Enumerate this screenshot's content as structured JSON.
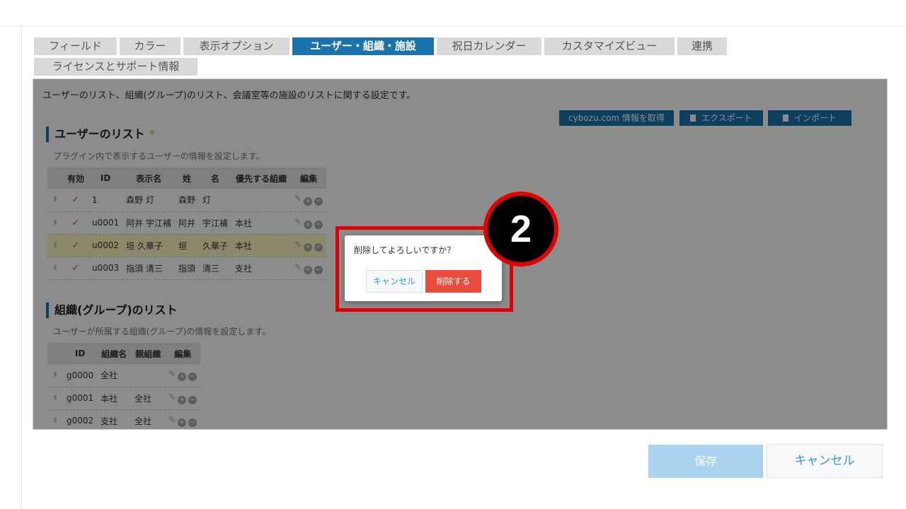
{
  "tabs": [
    {
      "label": "フィールド",
      "active": false
    },
    {
      "label": "カラー",
      "active": false
    },
    {
      "label": "表示オプション",
      "active": false
    },
    {
      "label": "ユーザー・組織・施設",
      "active": true
    },
    {
      "label": "祝日カレンダー",
      "active": false
    },
    {
      "label": "カスタマイズビュー",
      "active": false
    },
    {
      "label": "連携",
      "active": false
    },
    {
      "label": "ライセンスとサポート情報",
      "active": false
    }
  ],
  "panel": {
    "description": "ユーザーのリスト、組織(グループ)のリスト、会議室等の施設のリストに関する設定です。",
    "buttons": {
      "cybozu": "cybozu.com 情報を取得",
      "export": "エクスポート",
      "import": "インポート"
    }
  },
  "users": {
    "title": "ユーザーのリスト",
    "required_mark": "*",
    "description": "プラグイン内で表示するユーザーの情報を設定します。",
    "headers": {
      "enabled": "有効",
      "id": "ID",
      "display": "表示名",
      "last": "姓",
      "first": "名",
      "org": "優先する組織",
      "edit": "編集"
    },
    "rows": [
      {
        "id": "1",
        "display": "森野 灯",
        "last": "森野",
        "first": "灯",
        "org": ""
      },
      {
        "id": "u0001",
        "display": "阿井 宇江補",
        "last": "阿井",
        "first": "宇江補",
        "org": "本社"
      },
      {
        "id": "u0002",
        "display": "垣 久華子",
        "last": "垣",
        "first": "久華子",
        "org": "本社"
      },
      {
        "id": "u0003",
        "display": "指須 清三",
        "last": "指須",
        "first": "清三",
        "org": "支社"
      }
    ]
  },
  "groups": {
    "title": "組織(グループ)のリスト",
    "description": "ユーザーが所属する組織(グループ)の情報を設定します。",
    "headers": {
      "id": "ID",
      "name": "組織名",
      "parent": "親組織",
      "edit": "編集"
    },
    "rows": [
      {
        "id": "g0000",
        "name": "全社",
        "parent": ""
      },
      {
        "id": "g0001",
        "name": "本社",
        "parent": "全社"
      },
      {
        "id": "g0002",
        "name": "支社",
        "parent": "全社"
      }
    ]
  },
  "dialog": {
    "message": "削除してよろしいですか？",
    "cancel": "キャンセル",
    "delete": "削除する"
  },
  "step_number": "2",
  "footer": {
    "save": "保存",
    "cancel": "キャンセル"
  },
  "colors": {
    "accent": "#1a73ad",
    "danger": "#e74c3c",
    "annotation": "#e00000",
    "highlight_row": "#fff9c4"
  }
}
